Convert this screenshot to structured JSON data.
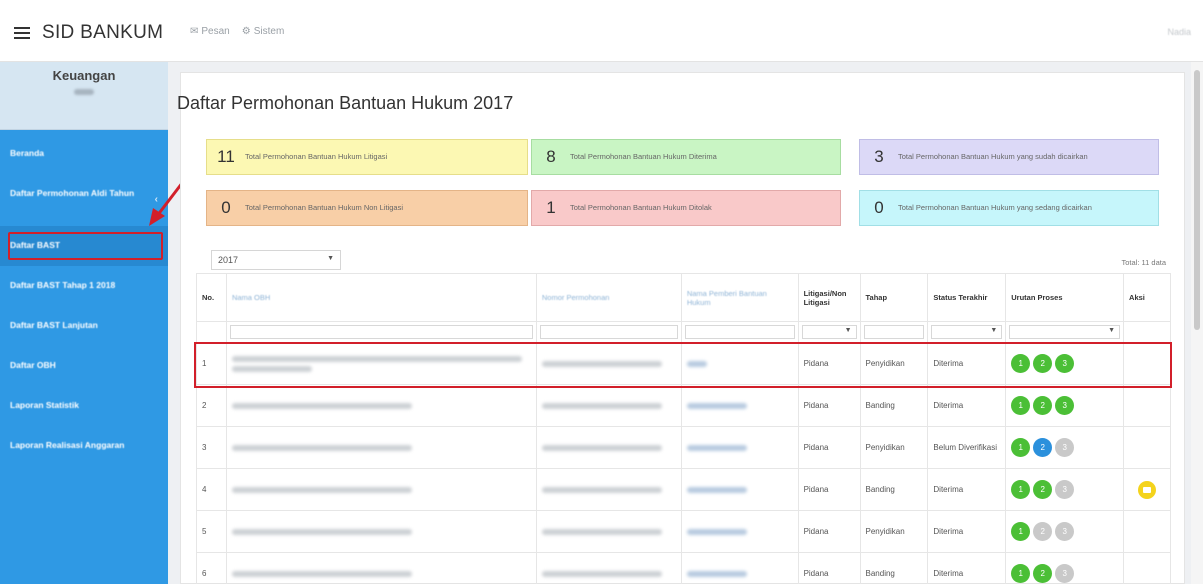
{
  "app": {
    "brand": "SID BANKUM"
  },
  "topnav": [
    {
      "icon": "mail-icon",
      "glyph": "✉",
      "label": "Pesan"
    },
    {
      "icon": "gear-icon",
      "glyph": "⚙",
      "label": "Sistem"
    }
  ],
  "user": {
    "name": "Nadia"
  },
  "sidebar": {
    "role": "Keuangan",
    "items": [
      {
        "label": "Beranda"
      },
      {
        "label": "Daftar Permohonan Aldi Tahun"
      },
      {
        "label": "Daftar BAST"
      },
      {
        "label": "Daftar BAST Tahap 1 2018"
      },
      {
        "label": "Daftar BAST Lanjutan"
      },
      {
        "label": "Daftar OBH"
      },
      {
        "label": "Laporan Statistik"
      },
      {
        "label": "Laporan Realisasi Anggaran"
      }
    ]
  },
  "page": {
    "title": "Daftar Permohonan Bantuan Hukum 2017"
  },
  "stats": [
    {
      "value": "11",
      "label": "Total Permohonan Bantuan Hukum Litigasi"
    },
    {
      "value": "8",
      "label": "Total Permohonan Bantuan Hukum Diterima"
    },
    {
      "value": "3",
      "label": "Total Permohonan Bantuan Hukum yang sudah dicairkan"
    },
    {
      "value": "0",
      "label": "Total Permohonan Bantuan Hukum Non Litigasi"
    },
    {
      "value": "1",
      "label": "Total Permohonan Bantuan Hukum Ditolak"
    },
    {
      "value": "0",
      "label": "Total Permohonan Bantuan Hukum yang sedang dicairkan"
    }
  ],
  "filter": {
    "year": "2017",
    "total": "Total: 11 data"
  },
  "table": {
    "headers": {
      "no": "No.",
      "nama": "Nama OBH",
      "nomor": "Nomor Permohonan",
      "pemberi": "Nama Pemberi Bantuan Hukum",
      "litigasi": "Litigasi/Non Litigasi",
      "tahap": "Tahap",
      "status": "Status Terakhir",
      "urutan": "Urutan Proses",
      "aksi": "Aksi"
    },
    "rows": [
      {
        "no": "1",
        "litigasi": "Pidana",
        "tahap": "Penyidikan",
        "status": "Diterima",
        "steps": [
          "green",
          "green",
          "green"
        ],
        "action": false
      },
      {
        "no": "2",
        "litigasi": "Pidana",
        "tahap": "Banding",
        "status": "Diterima",
        "steps": [
          "green",
          "green",
          "green"
        ],
        "action": false
      },
      {
        "no": "3",
        "litigasi": "Pidana",
        "tahap": "Penyidikan",
        "status": "Belum Diverifikasi",
        "steps": [
          "green",
          "blue",
          "gray"
        ],
        "action": false
      },
      {
        "no": "4",
        "litigasi": "Pidana",
        "tahap": "Banding",
        "status": "Diterima",
        "steps": [
          "green",
          "green",
          "gray"
        ],
        "action": true
      },
      {
        "no": "5",
        "litigasi": "Pidana",
        "tahap": "Penyidikan",
        "status": "Diterima",
        "steps": [
          "green",
          "gray",
          "gray"
        ],
        "action": false
      },
      {
        "no": "6",
        "litigasi": "Pidana",
        "tahap": "Banding",
        "status": "Diterima",
        "steps": [
          "green",
          "green",
          "gray"
        ],
        "action": false
      }
    ]
  }
}
